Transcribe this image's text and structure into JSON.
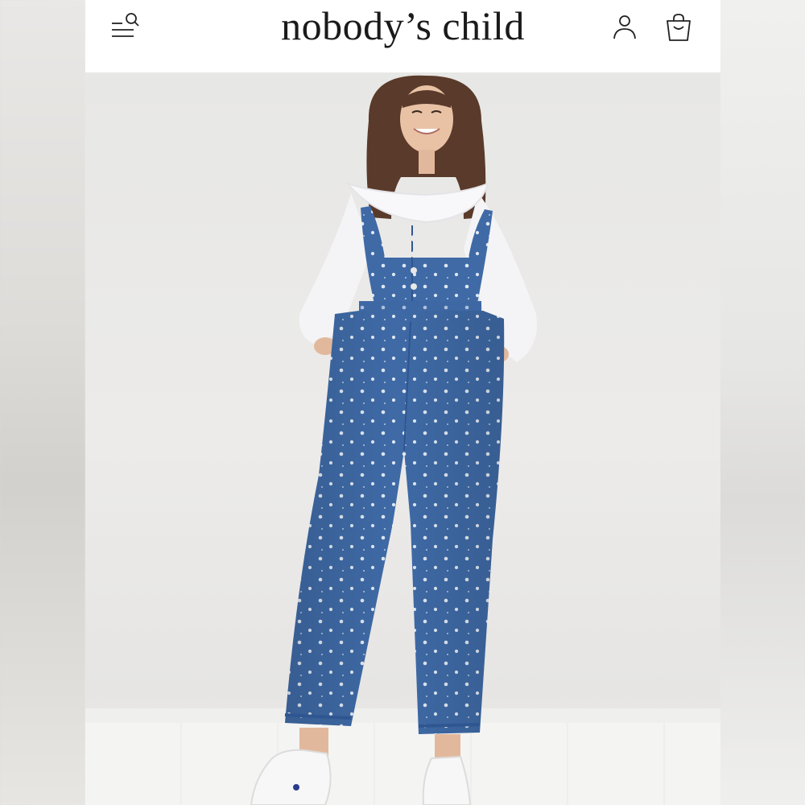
{
  "header": {
    "brand": "nobody’s child",
    "icons": {
      "menu": "menu-search-icon",
      "account": "user-icon",
      "bag": "shopping-bag-icon"
    }
  },
  "hero": {
    "image": "model-wearing-floral-denim-dungarees",
    "colors": {
      "denim": "#3f6aa6",
      "shirt": "#f4f4f6",
      "hair": "#5a3a2a"
    }
  }
}
